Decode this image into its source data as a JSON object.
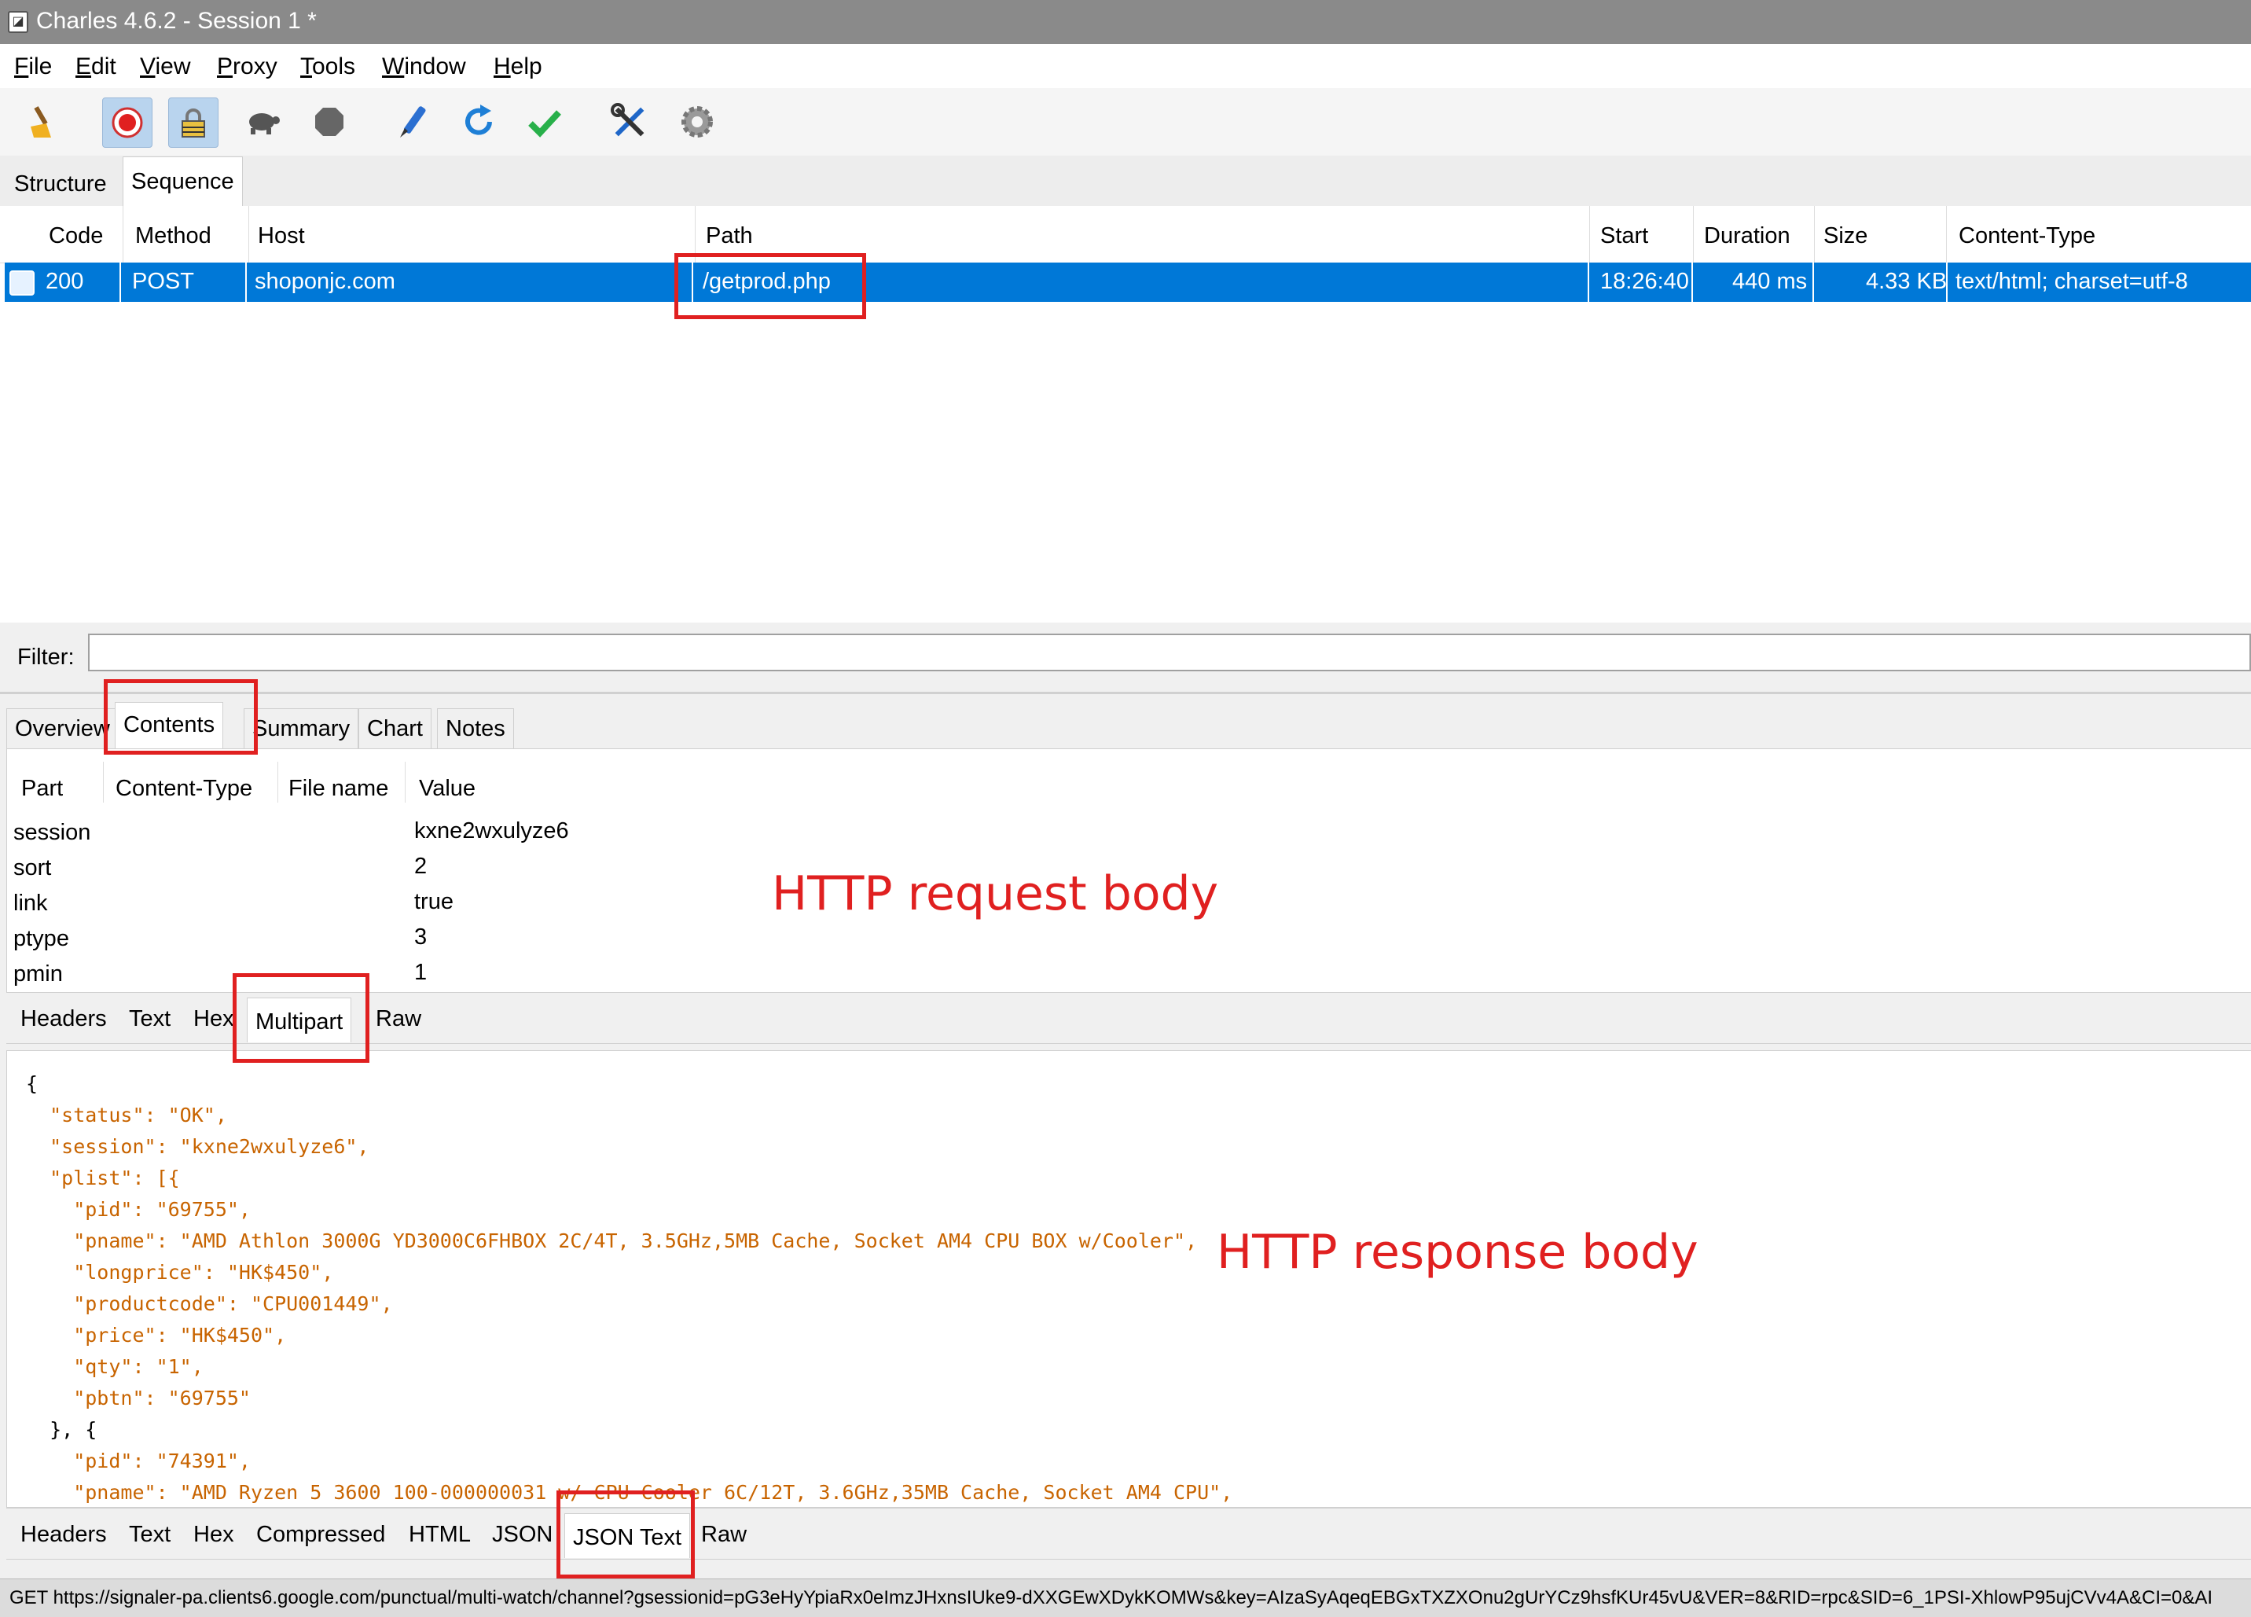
{
  "window": {
    "title": "Charles 4.6.2 - Session 1 *"
  },
  "menu": [
    {
      "label": "File",
      "u": "F",
      "rest": "ile"
    },
    {
      "label": "Edit",
      "u": "E",
      "rest": "dit"
    },
    {
      "label": "View",
      "u": "V",
      "rest": "iew"
    },
    {
      "label": "Proxy",
      "u": "P",
      "rest": "roxy"
    },
    {
      "label": "Tools",
      "u": "T",
      "rest": "ools"
    },
    {
      "label": "Window",
      "u": "W",
      "rest": "indow"
    },
    {
      "label": "Help",
      "u": "H",
      "rest": "elp"
    }
  ],
  "toolbar": {
    "icons": [
      "broom-icon",
      "record-icon",
      "ssl-proxy-icon",
      "throttle-icon",
      "breakpoint-icon",
      "compose-icon",
      "repeat-icon",
      "validate-icon",
      "tools-icon",
      "settings-icon"
    ]
  },
  "view_tabs": [
    "Structure",
    "Sequence"
  ],
  "sequence": {
    "columns": [
      "Code",
      "Method",
      "Host",
      "Path",
      "Start",
      "Duration",
      "Size",
      "Content-Type"
    ],
    "rows": [
      {
        "code": "200",
        "method": "POST",
        "host": "shoponjc.com",
        "path": "/getprod.php",
        "start": "18:26:40",
        "duration": "440 ms",
        "size": "4.33 KB",
        "content_type": "text/html; charset=utf-8"
      }
    ]
  },
  "filter": {
    "label": "Filter:",
    "value": ""
  },
  "detail_tabs": [
    "Overview",
    "Contents",
    "Summary",
    "Chart",
    "Notes"
  ],
  "multipart": {
    "columns": [
      "Part",
      "Content-Type",
      "File name",
      "Value"
    ],
    "rows": [
      {
        "part": "session",
        "value": "kxne2wxulyze6"
      },
      {
        "part": "sort",
        "value": "2"
      },
      {
        "part": "link",
        "value": "true"
      },
      {
        "part": "ptype",
        "value": "3"
      },
      {
        "part": "pmin",
        "value": "1"
      }
    ]
  },
  "request_subtabs": [
    "Headers",
    "Text",
    "Hex",
    "Multipart",
    "Raw"
  ],
  "response_subtabs": [
    "Headers",
    "Text",
    "Hex",
    "Compressed",
    "HTML",
    "JSON",
    "JSON Text",
    "Raw"
  ],
  "json_lines": [
    "{",
    "  \"status\": \"OK\",",
    "  \"session\": \"kxne2wxulyze6\",",
    "  \"plist\": [{",
    "    \"pid\": \"69755\",",
    "    \"pname\": \"AMD Athlon 3000G YD3000C6FHBOX 2C/4T, 3.5GHz,5MB Cache, Socket AM4 CPU BOX w/Cooler\",",
    "    \"longprice\": \"HK$450\",",
    "    \"productcode\": \"CPU001449\",",
    "    \"price\": \"HK$450\",",
    "    \"qty\": \"1\",",
    "    \"pbtn\": \"69755\"",
    "  }, {",
    "    \"pid\": \"74391\",",
    "    \"pname\": \"AMD Ryzen 5 3600 100-000000031 w/ CPU Cooler 6C/12T, 3.6GHz,35MB Cache, Socket AM4 CPU\","
  ],
  "status_bar": "GET https://signaler-pa.clients6.google.com/punctual/multi-watch/channel?gsessionid=pG3eHyYpiaRx0eImzJHxnsIUke9-dXXGEwXDykKOMWs&key=AIzaSyAqeqEBGxTXZXOnu2gUrYCz9hsfKUr45vU&VER=8&RID=rpc&SID=6_1PSI-XhlowP95ujCVv4A&CI=0&AI",
  "annotations": {
    "request_label": "HTTP request body",
    "response_label": "HTTP response body",
    "highlight_color": "#e02020"
  },
  "colors": {
    "selection": "#0078d7",
    "json_string": "#c86400"
  }
}
